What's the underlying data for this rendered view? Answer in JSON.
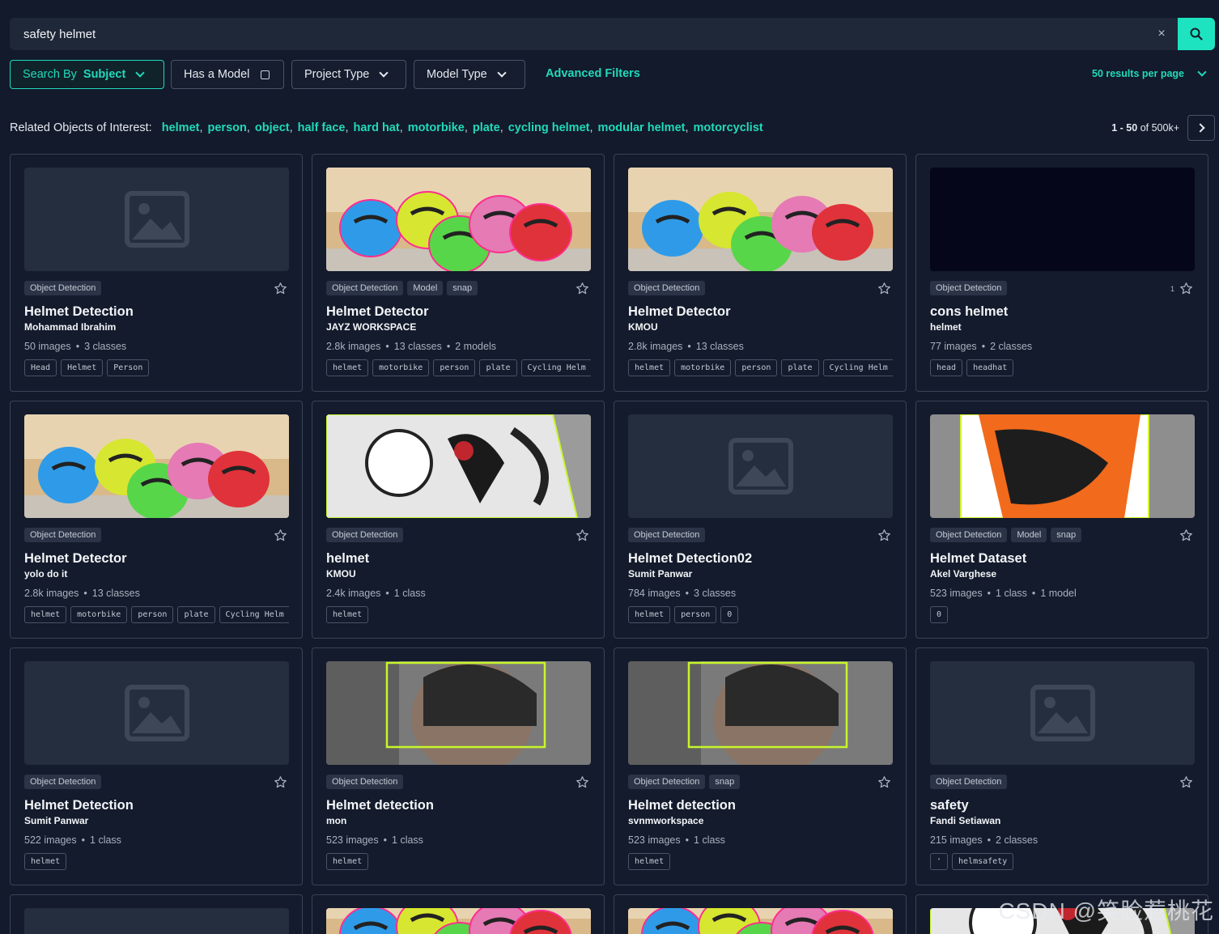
{
  "search": {
    "value": "safety helmet",
    "clear_icon": "×"
  },
  "filters": {
    "search_by_label": "Search By",
    "search_by_value": "Subject",
    "has_model": "Has a Model",
    "project_type": "Project Type",
    "model_type": "Model Type",
    "advanced": "Advanced Filters",
    "per_page": "50 results per page"
  },
  "related": {
    "label": "Related Objects of Interest:",
    "items": [
      "helmet",
      "person",
      "object",
      "half face",
      "hard hat",
      "motorbike",
      "plate",
      "cycling helmet",
      "modular helmet",
      "motorcyclist"
    ]
  },
  "pager": {
    "range": "1 - 50",
    "of": "of 500k+"
  },
  "colors": {
    "accent": "#22d9bb",
    "background": "#121a2b",
    "card_border": "#3a4457"
  },
  "cards": [
    {
      "thumb": "placeholder",
      "badges": [
        "Object Detection"
      ],
      "star_count": "",
      "title": "Helmet Detection",
      "owner": "Mohammad Ibrahim",
      "stats": [
        "50 images",
        "3 classes"
      ],
      "tags": [
        "Head",
        "Helmet",
        "Person"
      ]
    },
    {
      "thumb": "helmets-outline",
      "badges": [
        "Object Detection",
        "Model",
        "snap"
      ],
      "star_count": "",
      "title": "Helmet Detector",
      "owner": "JAYZ WORKSPACE",
      "stats": [
        "2.8k images",
        "13 classes",
        "2 models"
      ],
      "tags": [
        "helmet",
        "motorbike",
        "person",
        "plate",
        "Cycling Helm"
      ]
    },
    {
      "thumb": "helmets",
      "badges": [
        "Object Detection"
      ],
      "star_count": "",
      "title": "Helmet Detector",
      "owner": "KMOU",
      "stats": [
        "2.8k images",
        "13 classes"
      ],
      "tags": [
        "helmet",
        "motorbike",
        "person",
        "plate",
        "Cycling Helm"
      ]
    },
    {
      "thumb": "dark",
      "badges": [
        "Object Detection"
      ],
      "star_count": "1",
      "title": "cons helmet",
      "owner": "helmet",
      "stats": [
        "77 images",
        "2 classes"
      ],
      "tags": [
        "head",
        "headhat"
      ]
    },
    {
      "thumb": "helmets",
      "badges": [
        "Object Detection"
      ],
      "star_count": "",
      "title": "Helmet Detector",
      "owner": "yolo do it",
      "stats": [
        "2.8k images",
        "13 classes"
      ],
      "tags": [
        "helmet",
        "motorbike",
        "person",
        "plate",
        "Cycling Helm"
      ]
    },
    {
      "thumb": "graphic-helmet",
      "badges": [
        "Object Detection"
      ],
      "star_count": "",
      "title": "helmet",
      "owner": "KMOU",
      "stats": [
        "2.4k images",
        "1 class"
      ],
      "tags": [
        "helmet"
      ]
    },
    {
      "thumb": "placeholder",
      "badges": [
        "Object Detection"
      ],
      "star_count": "",
      "title": "Helmet Detection02",
      "owner": "Sumit Panwar",
      "stats": [
        "784 images",
        "3 classes"
      ],
      "tags": [
        "helmet",
        "person",
        "0"
      ]
    },
    {
      "thumb": "orange-helmet",
      "badges": [
        "Object Detection",
        "Model",
        "snap"
      ],
      "star_count": "",
      "title": "Helmet Dataset",
      "owner": "Akel Varghese",
      "stats": [
        "523 images",
        "1 class",
        "1 model"
      ],
      "tags": [
        "0"
      ]
    },
    {
      "thumb": "placeholder",
      "badges": [
        "Object Detection"
      ],
      "star_count": "",
      "title": "Helmet Detection",
      "owner": "Sumit Panwar",
      "stats": [
        "522 images",
        "1 class"
      ],
      "tags": [
        "helmet"
      ]
    },
    {
      "thumb": "rider",
      "badges": [
        "Object Detection"
      ],
      "star_count": "",
      "title": "Helmet detection",
      "owner": "mon",
      "stats": [
        "523 images",
        "1 class"
      ],
      "tags": [
        "helmet"
      ]
    },
    {
      "thumb": "rider",
      "badges": [
        "Object Detection",
        "snap"
      ],
      "star_count": "",
      "title": "Helmet detection",
      "owner": "svnmworkspace",
      "stats": [
        "523 images",
        "1 class"
      ],
      "tags": [
        "helmet"
      ]
    },
    {
      "thumb": "placeholder",
      "badges": [
        "Object Detection"
      ],
      "star_count": "",
      "title": "safety",
      "owner": "Fandi Setiawan",
      "stats": [
        "215 images",
        "2 classes"
      ],
      "tags": [
        "'",
        "helmsafety"
      ]
    }
  ],
  "partial_cards": [
    "placeholder",
    "helmets-outline",
    "helmets-outline",
    "graphic-helmet"
  ],
  "watermark": "CSDN @笑脸惹桃花"
}
